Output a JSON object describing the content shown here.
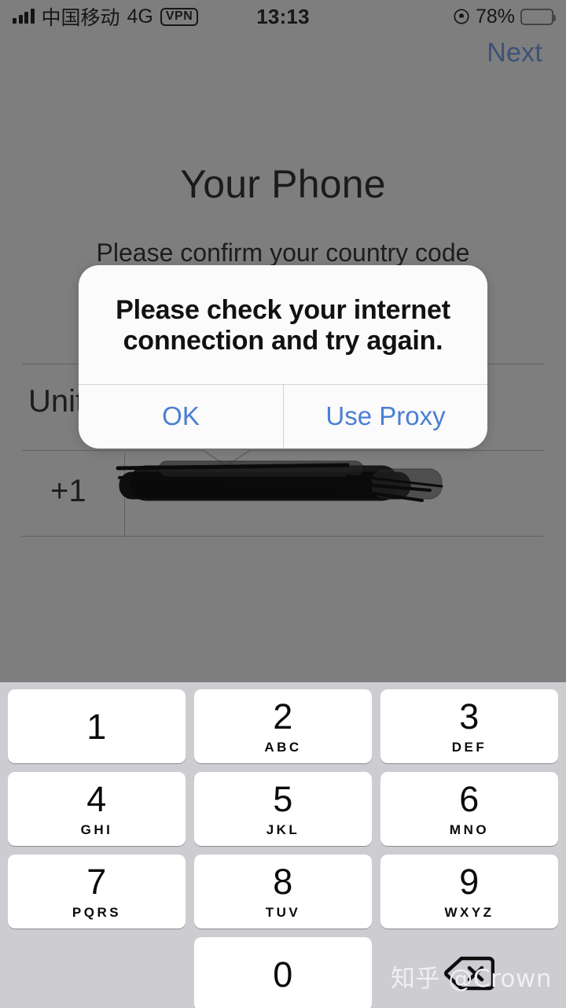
{
  "status_bar": {
    "carrier": "中国移动",
    "network_type": "4G",
    "vpn_badge": "VPN",
    "time": "13:13",
    "battery_percent": "78%",
    "signal_bars_filled": 4,
    "lock_icon": "rotation-lock-icon",
    "battery_icon": "battery-icon"
  },
  "nav": {
    "next_label": "Next"
  },
  "page": {
    "title": "Your Phone",
    "subtitle": "Please confirm your country code"
  },
  "form": {
    "country_value": "United States",
    "dial_code": "+1",
    "phone_number_value": "",
    "phone_number_redacted": true,
    "chevron_icon": "chevron-down-icon"
  },
  "alert": {
    "message": "Please check your internet connection and try again.",
    "ok_label": "OK",
    "use_proxy_label": "Use Proxy",
    "accent_color": "#4a7fd4"
  },
  "keyboard": {
    "rows": [
      [
        {
          "digit": "1",
          "letters": ""
        },
        {
          "digit": "2",
          "letters": "ABC"
        },
        {
          "digit": "3",
          "letters": "DEF"
        }
      ],
      [
        {
          "digit": "4",
          "letters": "GHI"
        },
        {
          "digit": "5",
          "letters": "JKL"
        },
        {
          "digit": "6",
          "letters": "MNO"
        }
      ],
      [
        {
          "digit": "7",
          "letters": "PQRS"
        },
        {
          "digit": "8",
          "letters": "TUV"
        },
        {
          "digit": "9",
          "letters": "WXYZ"
        }
      ],
      [
        {
          "digit": "",
          "letters": ""
        },
        {
          "digit": "0",
          "letters": ""
        },
        {
          "digit": "",
          "letters": "",
          "icon": "backspace-icon"
        }
      ]
    ],
    "background_color": "#ccccd1",
    "key_color": "#ffffff"
  },
  "watermark": {
    "text": "知乎 @Crown"
  },
  "theme": {
    "dim_overlay_color": "#7e7e7e",
    "alert_background": "#fbfbfb",
    "text_color": "#1b1b1b"
  }
}
